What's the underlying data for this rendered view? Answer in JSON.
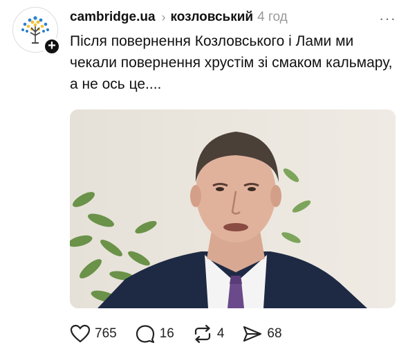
{
  "post": {
    "account": "cambridge.ua",
    "topic": "козловський",
    "time": "4 год",
    "more": "···",
    "text": "Після повернення Козловського і Лами ми чекали повернення хрустім зі смаком кальмару, а не ось це....",
    "avatar_icon": "tree-logo-icon",
    "follow_icon": "plus-icon",
    "image_description": "photo-thumbnail"
  },
  "actions": {
    "like_count": "765",
    "reply_count": "16",
    "repost_count": "4",
    "share_count": "68"
  },
  "colors": {
    "text": "#111111",
    "muted": "#999999",
    "logo_blue": "#2a7fd0",
    "logo_yellow": "#f2c230"
  }
}
